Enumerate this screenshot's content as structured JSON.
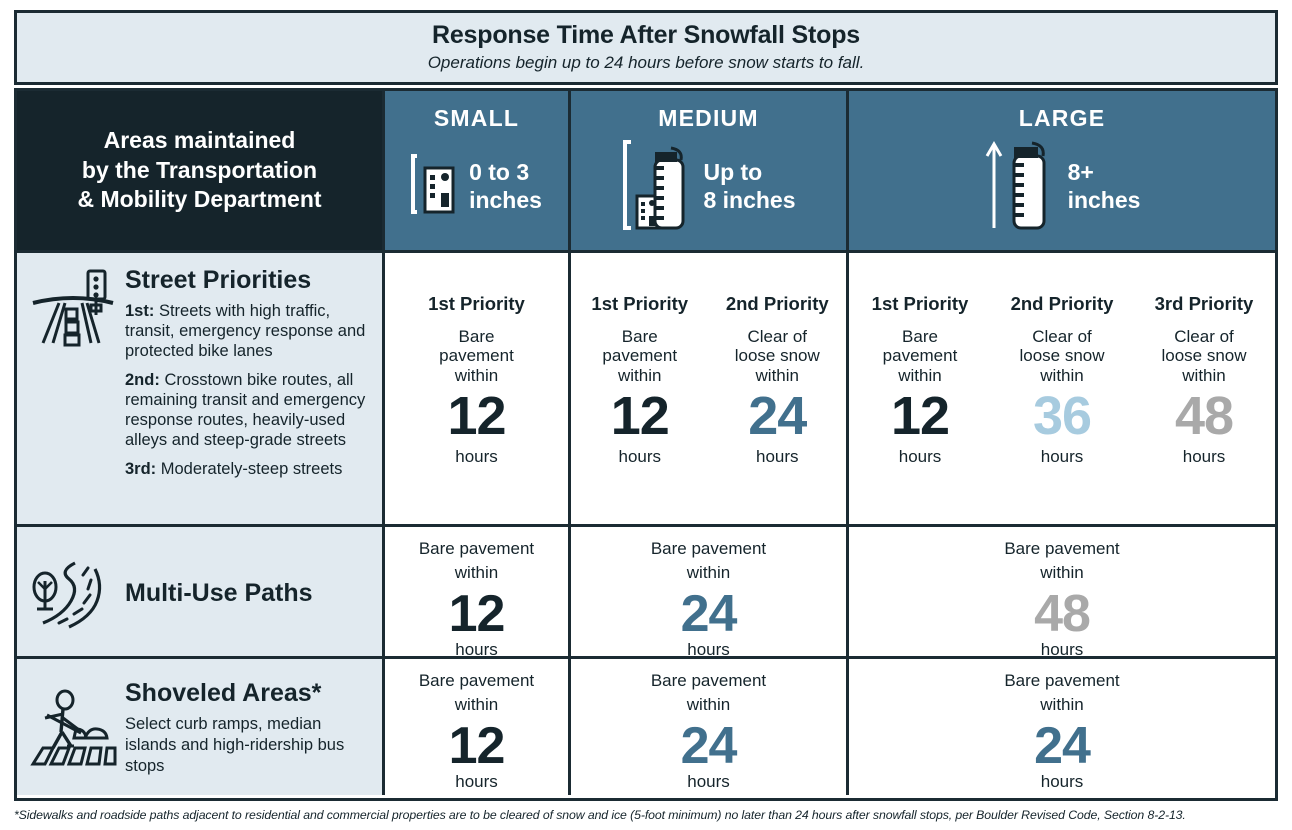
{
  "title": {
    "main": "Response Time After Snowfall Stops",
    "sub": "Operations begin up to 24 hours before snow starts to fall."
  },
  "header": {
    "row_label": {
      "line1": "Areas maintained",
      "line2": "by the Transportation",
      "line3": "& Mobility Department"
    },
    "columns": [
      {
        "name": "SMALL",
        "depth_line1": "0 to 3",
        "depth_line2": "inches",
        "icon": "small-building-measure-icon"
      },
      {
        "name": "MEDIUM",
        "depth_line1": "Up to",
        "depth_line2": "8 inches",
        "icon": "medium-bottle-measure-icon"
      },
      {
        "name": "LARGE",
        "depth_line1": "8+",
        "depth_line2": "inches",
        "icon": "large-bottle-arrow-icon"
      }
    ]
  },
  "colors": {
    "navy": "#15242b",
    "blue": "#41708d",
    "light_blue": "#a7cbdf",
    "gray": "#a9a9a9",
    "panel": "#e1eaf0",
    "border": "#1b2b33"
  },
  "rows": [
    {
      "id": "street-priorities",
      "icon": "road-traffic-signal-icon",
      "title": "Street Priorities",
      "priorities": [
        {
          "rank": "1st:",
          "text": "Streets with high traffic, transit, emergency response and protected bike lanes"
        },
        {
          "rank": "2nd:",
          "text": "Crosstown bike routes, all remaining transit and emergency response routes, heavily-used alleys and steep-grade streets"
        },
        {
          "rank": "3rd:",
          "text": "Moderately-steep streets"
        }
      ],
      "small": [
        {
          "priority": "1st Priority",
          "desc": "Bare\npavement\nwithin",
          "value": "12",
          "unit": "hours",
          "color": "#15242b"
        }
      ],
      "medium": [
        {
          "priority": "1st Priority",
          "desc": "Bare\npavement\nwithin",
          "value": "12",
          "unit": "hours",
          "color": "#15242b"
        },
        {
          "priority": "2nd Priority",
          "desc": "Clear of\nloose snow\nwithin",
          "value": "24",
          "unit": "hours",
          "color": "#41708d"
        }
      ],
      "large": [
        {
          "priority": "1st Priority",
          "desc": "Bare\npavement\nwithin",
          "value": "12",
          "unit": "hours",
          "color": "#15242b"
        },
        {
          "priority": "2nd Priority",
          "desc": "Clear of\nloose snow\nwithin",
          "value": "36",
          "unit": "hours",
          "color": "#a7cbdf"
        },
        {
          "priority": "3rd Priority",
          "desc": "Clear of\nloose snow\nwithin",
          "value": "48",
          "unit": "hours",
          "color": "#a9a9a9"
        }
      ]
    },
    {
      "id": "multi-use-paths",
      "icon": "winding-path-tree-icon",
      "title": "Multi-Use Paths",
      "subtitle": "",
      "small": {
        "desc1": "Bare pavement",
        "desc2": "within",
        "value": "12",
        "unit": "hours",
        "color": "#15242b"
      },
      "medium": {
        "desc1": "Bare pavement",
        "desc2": "within",
        "value": "24",
        "unit": "hours",
        "color": "#41708d"
      },
      "large": {
        "desc1": "Bare pavement",
        "desc2": "within",
        "value": "48",
        "unit": "hours",
        "color": "#a9a9a9"
      }
    },
    {
      "id": "shoveled-areas",
      "icon": "person-shoveling-crosswalk-icon",
      "title": "Shoveled Areas*",
      "subtitle": "Select curb ramps, median islands and high-ridership bus stops",
      "small": {
        "desc1": "Bare pavement",
        "desc2": "within",
        "value": "12",
        "unit": "hours",
        "color": "#15242b"
      },
      "medium": {
        "desc1": "Bare pavement",
        "desc2": "within",
        "value": "24",
        "unit": "hours",
        "color": "#41708d"
      },
      "large": {
        "desc1": "Bare pavement",
        "desc2": "within",
        "value": "24",
        "unit": "hours",
        "color": "#41708d"
      }
    }
  ],
  "footnote": "*Sidewalks and roadside paths adjacent to residential and commercial properties are to be cleared of snow and ice (5-foot minimum) no later than 24 hours after snowfall stops, per Boulder Revised Code, Section 8-2-13."
}
